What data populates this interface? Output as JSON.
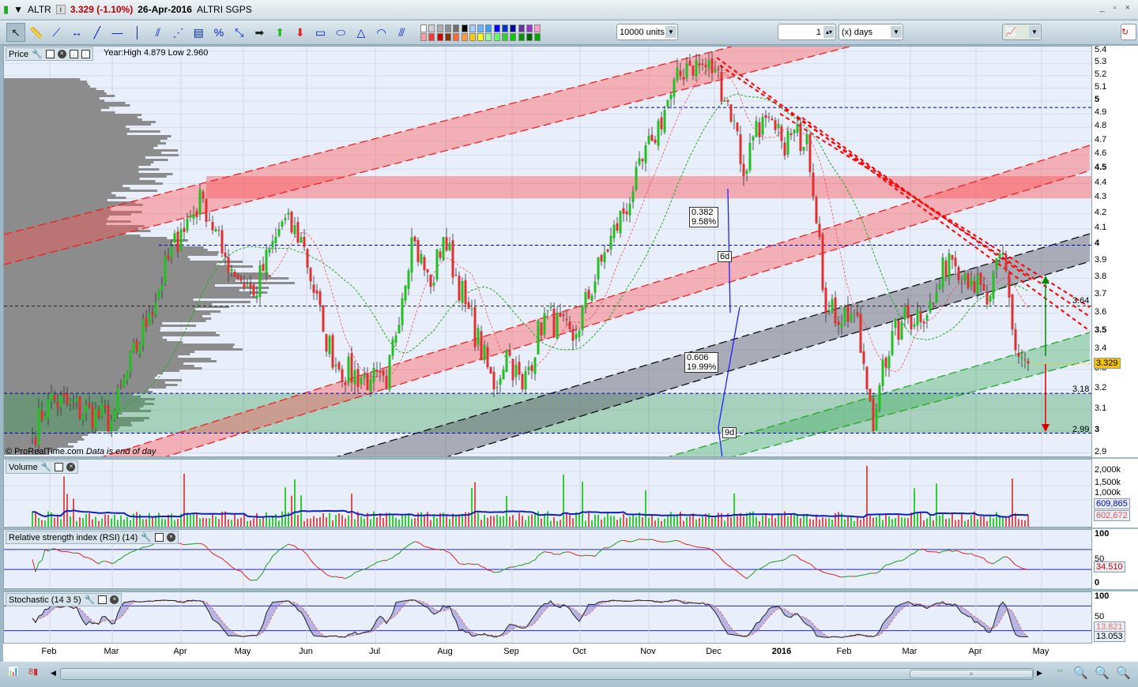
{
  "title": {
    "symbol": "ALTR",
    "price": "3.329 (-1.10%)",
    "date": "26-Apr-2016",
    "name": "ALTRI SGPS",
    "window_controls": "_ ▫ ×"
  },
  "toolbar": {
    "units": "10000 units",
    "period_value": "1",
    "period_unit": "(x) days",
    "tools": [
      "pointer",
      "ruler",
      "segment",
      "horizontal-segment",
      "line",
      "horizontal-line",
      "vertical-line",
      "channel",
      "fan",
      "fibonacci",
      "percent-level",
      "point-to-point",
      "arrow",
      "up-arrow",
      "down-arrow",
      "rectangle",
      "ellipse",
      "triangle",
      "arc",
      "parallel-lines"
    ],
    "colors_top": [
      "#ffffff",
      "#d0d0d0",
      "#b0b0b0",
      "#909090",
      "#707070",
      "#000000",
      "#a9c8ff",
      "#66b3ff",
      "#33a0ff",
      "#0000ff",
      "#0033cc",
      "#000099",
      "#663399",
      "#9933cc",
      "#ff99cc"
    ],
    "colors_bottom": [
      "#ff9999",
      "#ff3333",
      "#cc0000",
      "#883300",
      "#ff6633",
      "#ff9933",
      "#ffcc00",
      "#ffff00",
      "#99ff99",
      "#66ff66",
      "#33cc33",
      "#00cc00",
      "#009900",
      "#006600",
      "#00aa00"
    ]
  },
  "price_panel": {
    "label": "Price",
    "year_info": "Year:High 4.879 Low 2.960",
    "copyright": "© ProRealTime.com",
    "data_note": "Data is end of day",
    "ticks": [
      "5.4",
      "5.3",
      "5.2",
      "5.1",
      "5",
      "4.9",
      "4.8",
      "4.7",
      "4.6",
      "4.5",
      "4.4",
      "4.3",
      "4.2",
      "4.1",
      "4",
      "3.9",
      "3.8",
      "3.7",
      "3.6",
      "3.5",
      "3.4",
      "3.3",
      "3.2",
      "3.1",
      "3",
      "2.9"
    ],
    "bold_ticks": [
      "5",
      "4.5",
      "4",
      "3.5",
      "3"
    ],
    "last_price": "3.329",
    "last_color": "#f5c400",
    "level_labels": {
      "l364": "3.64",
      "l318": "3.18",
      "l299": "2.99"
    },
    "fib1": {
      "ratio": "0.382",
      "pct": "9.58%",
      "days": "6d"
    },
    "fib2": {
      "ratio": "0.606",
      "pct": "19.99%",
      "days": "9d"
    }
  },
  "volume_panel": {
    "label": "Volume",
    "ticks": [
      "2,000k",
      "1,500k",
      "1,000k"
    ],
    "value_blue": "609,865",
    "value_red": "602,672"
  },
  "rsi_panel": {
    "label": "Relative strength index (RSI) (14)",
    "ticks": [
      "100",
      "50",
      "0"
    ],
    "value": "34.510"
  },
  "stoch_panel": {
    "label": "Stochastic (14 3 5)",
    "ticks": [
      "100",
      "50"
    ],
    "value_red": "13.821",
    "value_black": "13.053"
  },
  "months": [
    "Feb",
    "Mar",
    "Apr",
    "May",
    "Jun",
    "Jul",
    "Aug",
    "Sep",
    "Oct",
    "Nov",
    "Dec",
    "2016",
    "Feb",
    "Mar",
    "Apr",
    "May"
  ],
  "chart_data": {
    "type": "candlestick",
    "title": "ALTR",
    "ylim": [
      2.9,
      5.4
    ],
    "scale": "log",
    "keypoints_day_close": [
      [
        0,
        2.98
      ],
      [
        5,
        3.15
      ],
      [
        25,
        3.05
      ],
      [
        37,
        3.6
      ],
      [
        47,
        4.1
      ],
      [
        54,
        4.3
      ],
      [
        60,
        3.95
      ],
      [
        70,
        3.7
      ],
      [
        79,
        4.15
      ],
      [
        85,
        4.05
      ],
      [
        92,
        3.5
      ],
      [
        97,
        3.3
      ],
      [
        107,
        3.25
      ],
      [
        112,
        3.2
      ],
      [
        120,
        4.05
      ],
      [
        126,
        3.75
      ],
      [
        130,
        4.05
      ],
      [
        137,
        3.65
      ],
      [
        146,
        3.2
      ],
      [
        150,
        3.4
      ],
      [
        155,
        3.2
      ],
      [
        162,
        3.6
      ],
      [
        171,
        3.45
      ],
      [
        180,
        3.9
      ],
      [
        190,
        4.35
      ],
      [
        196,
        4.7
      ],
      [
        202,
        5.05
      ],
      [
        207,
        5.3
      ],
      [
        216,
        5.25
      ],
      [
        222,
        4.85
      ],
      [
        225,
        4.45
      ],
      [
        229,
        4.85
      ],
      [
        237,
        4.7
      ],
      [
        245,
        4.75
      ],
      [
        249,
        4.05
      ],
      [
        251,
        3.6
      ],
      [
        260,
        3.6
      ],
      [
        264,
        3.2
      ],
      [
        266,
        3.0
      ],
      [
        269,
        3.35
      ],
      [
        275,
        3.55
      ],
      [
        285,
        3.65
      ],
      [
        290,
        3.95
      ],
      [
        297,
        3.8
      ],
      [
        302,
        3.65
      ],
      [
        307,
        3.95
      ],
      [
        311,
        3.4
      ],
      [
        315,
        3.33
      ]
    ]
  }
}
